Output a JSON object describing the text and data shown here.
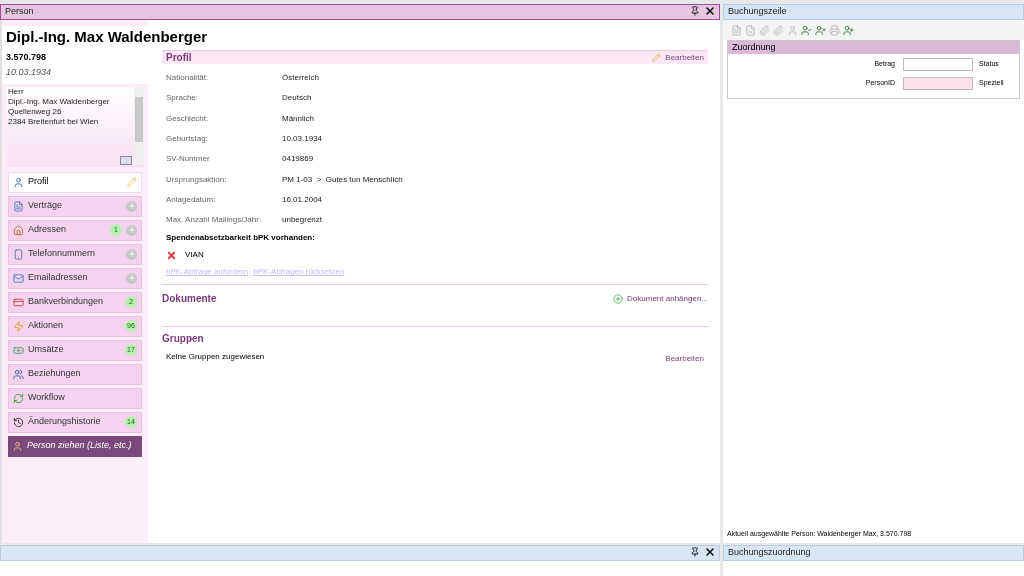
{
  "left_pane": {
    "title": "Person"
  },
  "person": {
    "name": "Dipl.-Ing. Max Waldenberger",
    "number": "3.570.798",
    "birthdate": "10.03.1934",
    "address_lines": [
      "Herr",
      "Dipl.-Ing. Max Waldenberger",
      "Quellenweg 26",
      "2384 Breitenfurt bei Wien"
    ]
  },
  "nav": [
    {
      "label": "Profil",
      "kind": "item",
      "selected": true,
      "add": false,
      "edit": true
    },
    {
      "label": "Verträge",
      "kind": "item",
      "selected": false,
      "add": true,
      "edit": false
    },
    {
      "label": "Adressen",
      "kind": "item",
      "selected": false,
      "badge": "1",
      "add": true,
      "edit": false
    },
    {
      "label": "Telefonnummern",
      "kind": "item",
      "selected": false,
      "add": true,
      "edit": false
    },
    {
      "label": "Emailadressen",
      "kind": "item",
      "selected": false,
      "add": true,
      "edit": false
    },
    {
      "label": "Bankverbindungen",
      "kind": "item",
      "selected": false,
      "badge": "2",
      "add": false,
      "edit": false
    },
    {
      "label": "Aktionen",
      "kind": "item",
      "selected": false,
      "badge": "96",
      "add": false,
      "edit": false
    },
    {
      "label": "Umsätze",
      "kind": "item",
      "selected": false,
      "badge": "17",
      "add": false,
      "edit": false
    },
    {
      "label": "Beziehungen",
      "kind": "item",
      "selected": false,
      "add": false,
      "edit": false
    },
    {
      "label": "Workflow",
      "kind": "item",
      "selected": false,
      "add": false,
      "edit": false
    },
    {
      "label": "Änderungshistorie",
      "kind": "item",
      "selected": false,
      "badge": "14",
      "add": false,
      "edit": false
    },
    {
      "label": "Person ziehen (Liste, etc.)",
      "kind": "action"
    }
  ],
  "profile": {
    "title": "Profil",
    "edit": "Bearbeiten",
    "fields": [
      {
        "label": "Nationalität:",
        "value": "Österreich"
      },
      {
        "label": "Sprache:",
        "value": "Deutsch"
      },
      {
        "label": "Geschlecht:",
        "value": "Männlich"
      },
      {
        "label": "Geburtstag:",
        "value": "10.03.1934"
      },
      {
        "label": "SV-Nummer",
        "value": "0419869"
      },
      {
        "label": "Ursprungsaktion:",
        "value": "PM 1-03  >  Gutes tun Menschlich"
      },
      {
        "label": "Anlagedatum:",
        "value": "16.01.2004"
      },
      {
        "label": "Max. Anzahl Mailings/Jahr:",
        "value": "unbegrenzt"
      }
    ],
    "bpk_heading": "Spendenabsetzbarkeit bPK vorhanden:",
    "bpk_items": [
      {
        "label": "VIAN",
        "available": false
      }
    ],
    "links": [
      {
        "label": "bPK-Abfrage anfordern",
        "disabled": true
      },
      {
        "label": "bPK-Abfragen rücksetzen",
        "disabled": true
      }
    ]
  },
  "documents": {
    "title": "Dokumente",
    "action": "Dokument anhängen..."
  },
  "groups": {
    "title": "Gruppen",
    "empty": "Keine Gruppen zugewiesen",
    "edit": "Bearbeiten"
  },
  "right_pane": {
    "title": "Buchungszeile",
    "toolbar": [
      {
        "disabled": true
      },
      {
        "disabled": true
      },
      {
        "disabled": true
      },
      {
        "disabled": true
      },
      {
        "disabled": true
      },
      {
        "disabled": false
      },
      {
        "disabled": false
      },
      {
        "disabled": true
      },
      {
        "disabled": false
      }
    ],
    "section": "Zuordnung",
    "fields": [
      {
        "label": "Betrag",
        "highlighted": false,
        "right_label": "Status"
      },
      {
        "label": "PersonID",
        "highlighted": true,
        "right_label": "Speziell"
      }
    ],
    "status": "Aktuell ausgewählte Person: Waldenberger Max, 3.570.798"
  },
  "bottom_right_pane": {
    "title": "Buchungszuordnung"
  }
}
